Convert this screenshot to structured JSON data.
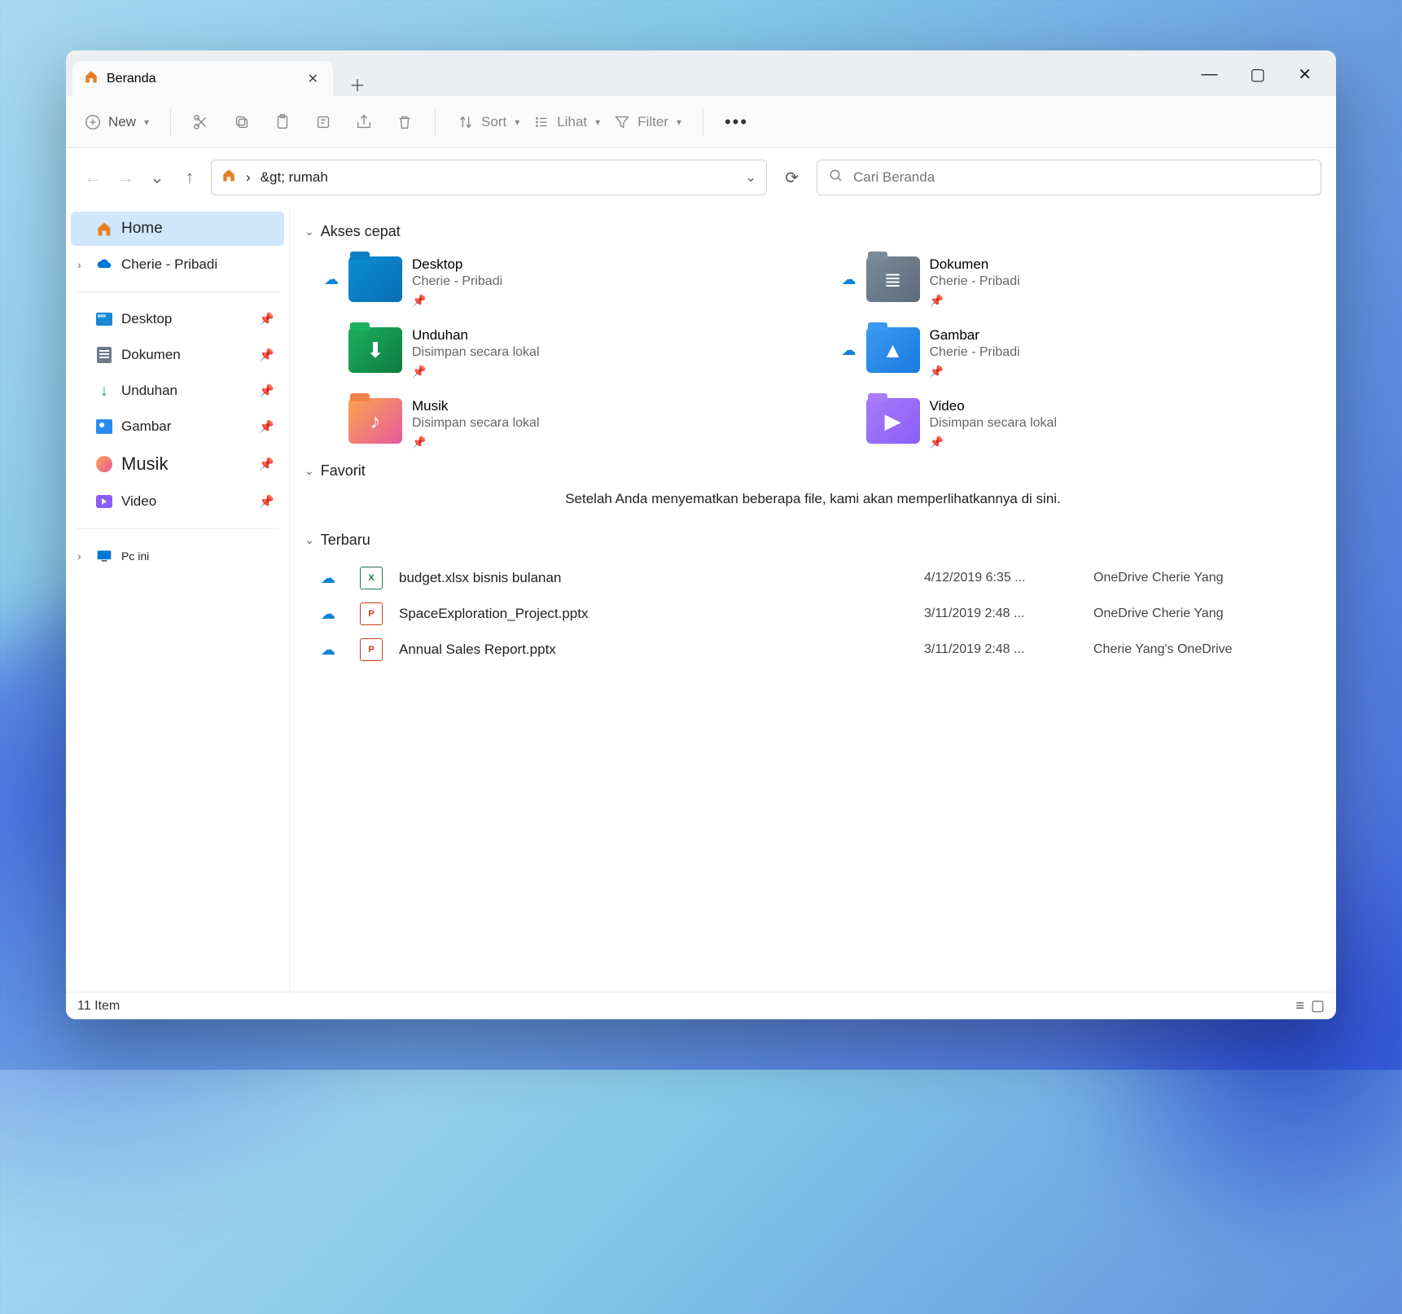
{
  "tab": {
    "label": "Beranda"
  },
  "toolbar": {
    "new": "New",
    "sort": "Sort",
    "view": "Lihat",
    "filter": "Filter"
  },
  "address": {
    "path": "&gt; rumah"
  },
  "search": {
    "placeholder": "Cari Beranda"
  },
  "sidebar": {
    "home": "Home",
    "onedrive": "Cherie - Pribadi",
    "desktop": "Desktop",
    "documents": "Dokumen",
    "downloads": "Unduhan",
    "pictures": "Gambar",
    "music": "Musik",
    "video": "Video",
    "thispc": "Pc ini"
  },
  "sections": {
    "quick": "Akses cepat",
    "favorites": "Favorit",
    "recent": "Terbaru"
  },
  "quick": [
    {
      "name": "Desktop",
      "sub": "Cherie - Pribadi",
      "cloud": true,
      "kind": "desktop"
    },
    {
      "name": "Dokumen",
      "sub": "Cherie - Pribadi",
      "cloud": true,
      "kind": "doc"
    },
    {
      "name": "Unduhan",
      "sub": "Disimpan secara lokal",
      "cloud": false,
      "kind": "dl"
    },
    {
      "name": "Gambar",
      "sub": "Cherie - Pribadi",
      "cloud": true,
      "kind": "pic"
    },
    {
      "name": "Musik",
      "sub": "Disimpan secara lokal",
      "cloud": false,
      "kind": "music"
    },
    {
      "name": "Video",
      "sub": "Disimpan secara lokal",
      "cloud": false,
      "kind": "video"
    }
  ],
  "favorites_empty": "Setelah Anda menyematkan beberapa file, kami akan memperlihatkannya di sini.",
  "recent": [
    {
      "name": "budget.xlsx bisnis bulanan",
      "date": "4/12/2019 6:35 ...",
      "loc": "OneDrive Cherie Yang",
      "type": "xlsx"
    },
    {
      "name": "SpaceExploration_Project.pptx",
      "date": "3/11/2019 2:48 ...",
      "loc": "OneDrive Cherie Yang",
      "type": "pptx"
    },
    {
      "name": "Annual Sales Report.pptx",
      "date": "3/11/2019 2:48 ...",
      "loc": "Cherie Yang's OneDrive",
      "type": "pptx"
    }
  ],
  "status": {
    "count": "11",
    "label": "Item"
  }
}
